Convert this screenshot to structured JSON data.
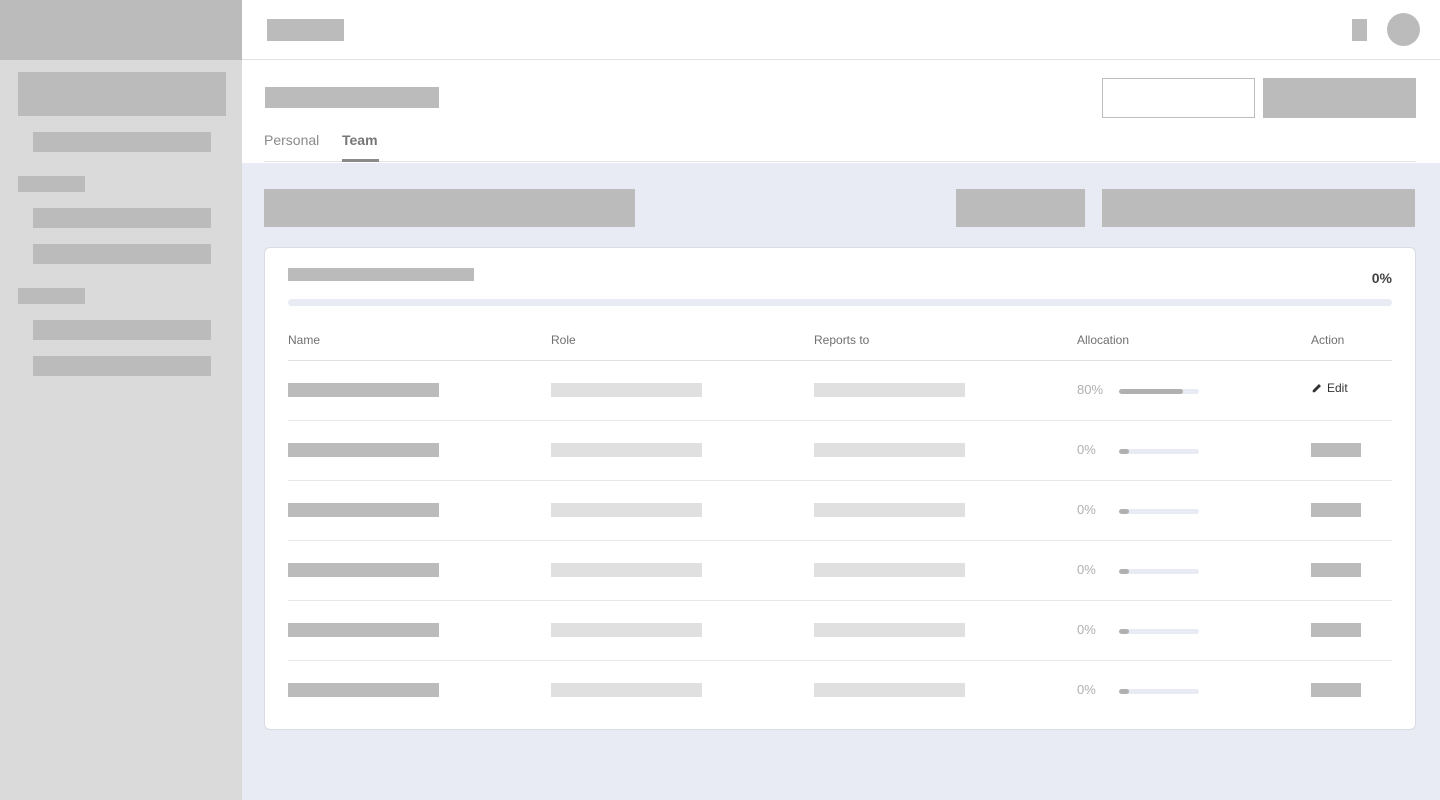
{
  "tabs": [
    {
      "label": "Personal",
      "active": false
    },
    {
      "label": "Team",
      "active": true
    }
  ],
  "overall": {
    "percent_label": "0%",
    "progress": 0
  },
  "table": {
    "columns": [
      "Name",
      "Role",
      "Reports to",
      "Allocation",
      "Action"
    ],
    "rows": [
      {
        "allocation_label": "80%",
        "allocation": 0.8,
        "action_label": "Edit",
        "action_icon": "pencil-icon"
      },
      {
        "allocation_label": "0%",
        "allocation": 0.0
      },
      {
        "allocation_label": "0%",
        "allocation": 0.0
      },
      {
        "allocation_label": "0%",
        "allocation": 0.0
      },
      {
        "allocation_label": "0%",
        "allocation": 0.0
      },
      {
        "allocation_label": "0%",
        "allocation": 0.0
      }
    ]
  },
  "colors": {
    "content_bg": "#e8ebf3",
    "placeholder": "#bbbbbb",
    "placeholder_light": "#e0e0e0",
    "sidebar_bg": "#dadada"
  }
}
